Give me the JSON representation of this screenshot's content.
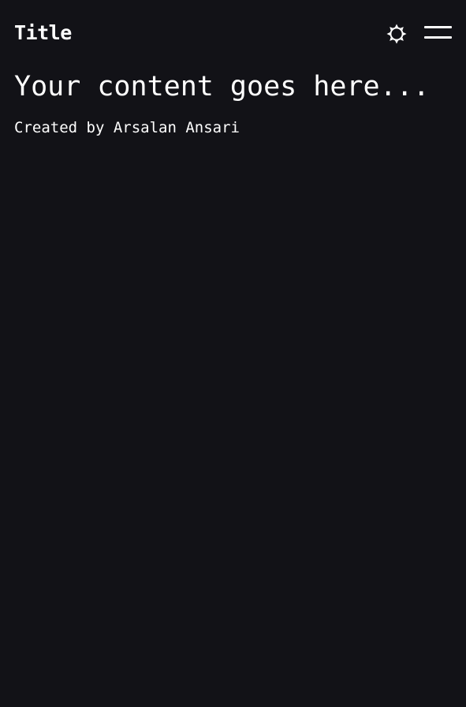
{
  "header": {
    "title": "Title",
    "theme_toggle_icon": "sun-icon",
    "menu_icon": "hamburger-menu-icon"
  },
  "main": {
    "heading": "Your content goes here...",
    "credit": "Created by Arsalan Ansari"
  },
  "colors": {
    "background": "#121217",
    "text": "#ffffff"
  }
}
